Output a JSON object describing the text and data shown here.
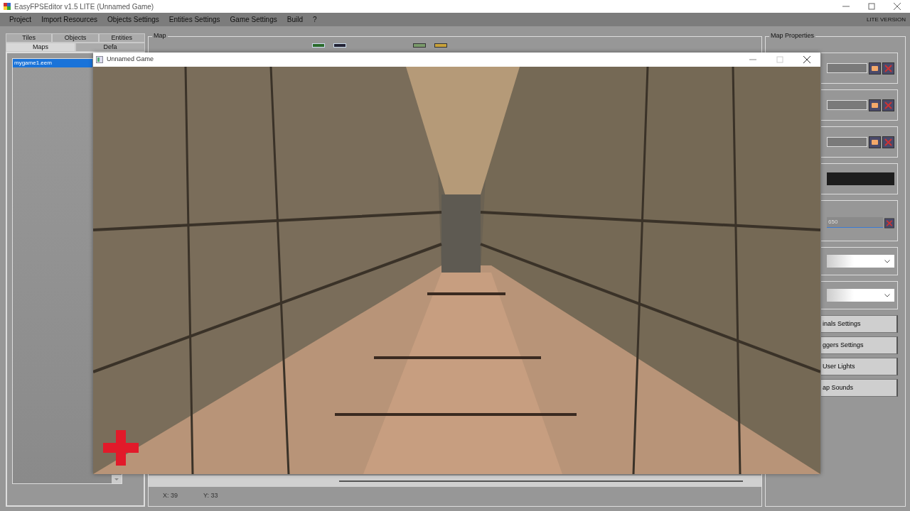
{
  "window": {
    "title": "EasyFPSEditor v1.5 LITE (Unnamed Game)"
  },
  "menu": [
    "Project",
    "Import Resources",
    "Objects Settings",
    "Entities Settings",
    "Game Settings",
    "Build",
    "?"
  ],
  "edition_label": "LITE VERSION",
  "left_tab_rows": [
    {
      "tabs": [
        {
          "label": "Tiles",
          "selected": false
        },
        {
          "label": "Objects",
          "selected": false
        },
        {
          "label": "Entities",
          "selected": false
        }
      ]
    },
    {
      "tabs": [
        {
          "label": "Maps",
          "selected": true
        },
        {
          "label": "Defa",
          "selected": false
        }
      ]
    }
  ],
  "maps_list": [
    {
      "name": "mygame1.eem",
      "selected": true
    }
  ],
  "map_group": {
    "title": "Map"
  },
  "status": {
    "x": "X: 39",
    "y": "Y: 33"
  },
  "properties": {
    "title": "Map Properties",
    "fields": [
      {
        "kind": "file"
      },
      {
        "kind": "file"
      },
      {
        "kind": "file"
      },
      {
        "kind": "color"
      },
      {
        "kind": "color_value",
        "value": "650"
      },
      {
        "kind": "dropdown"
      },
      {
        "kind": "dropdown"
      }
    ],
    "buttons": [
      "inals Settings",
      "ggers Settings",
      "User Lights",
      "ap Sounds"
    ]
  },
  "game_window": {
    "title": "Unnamed Game"
  }
}
